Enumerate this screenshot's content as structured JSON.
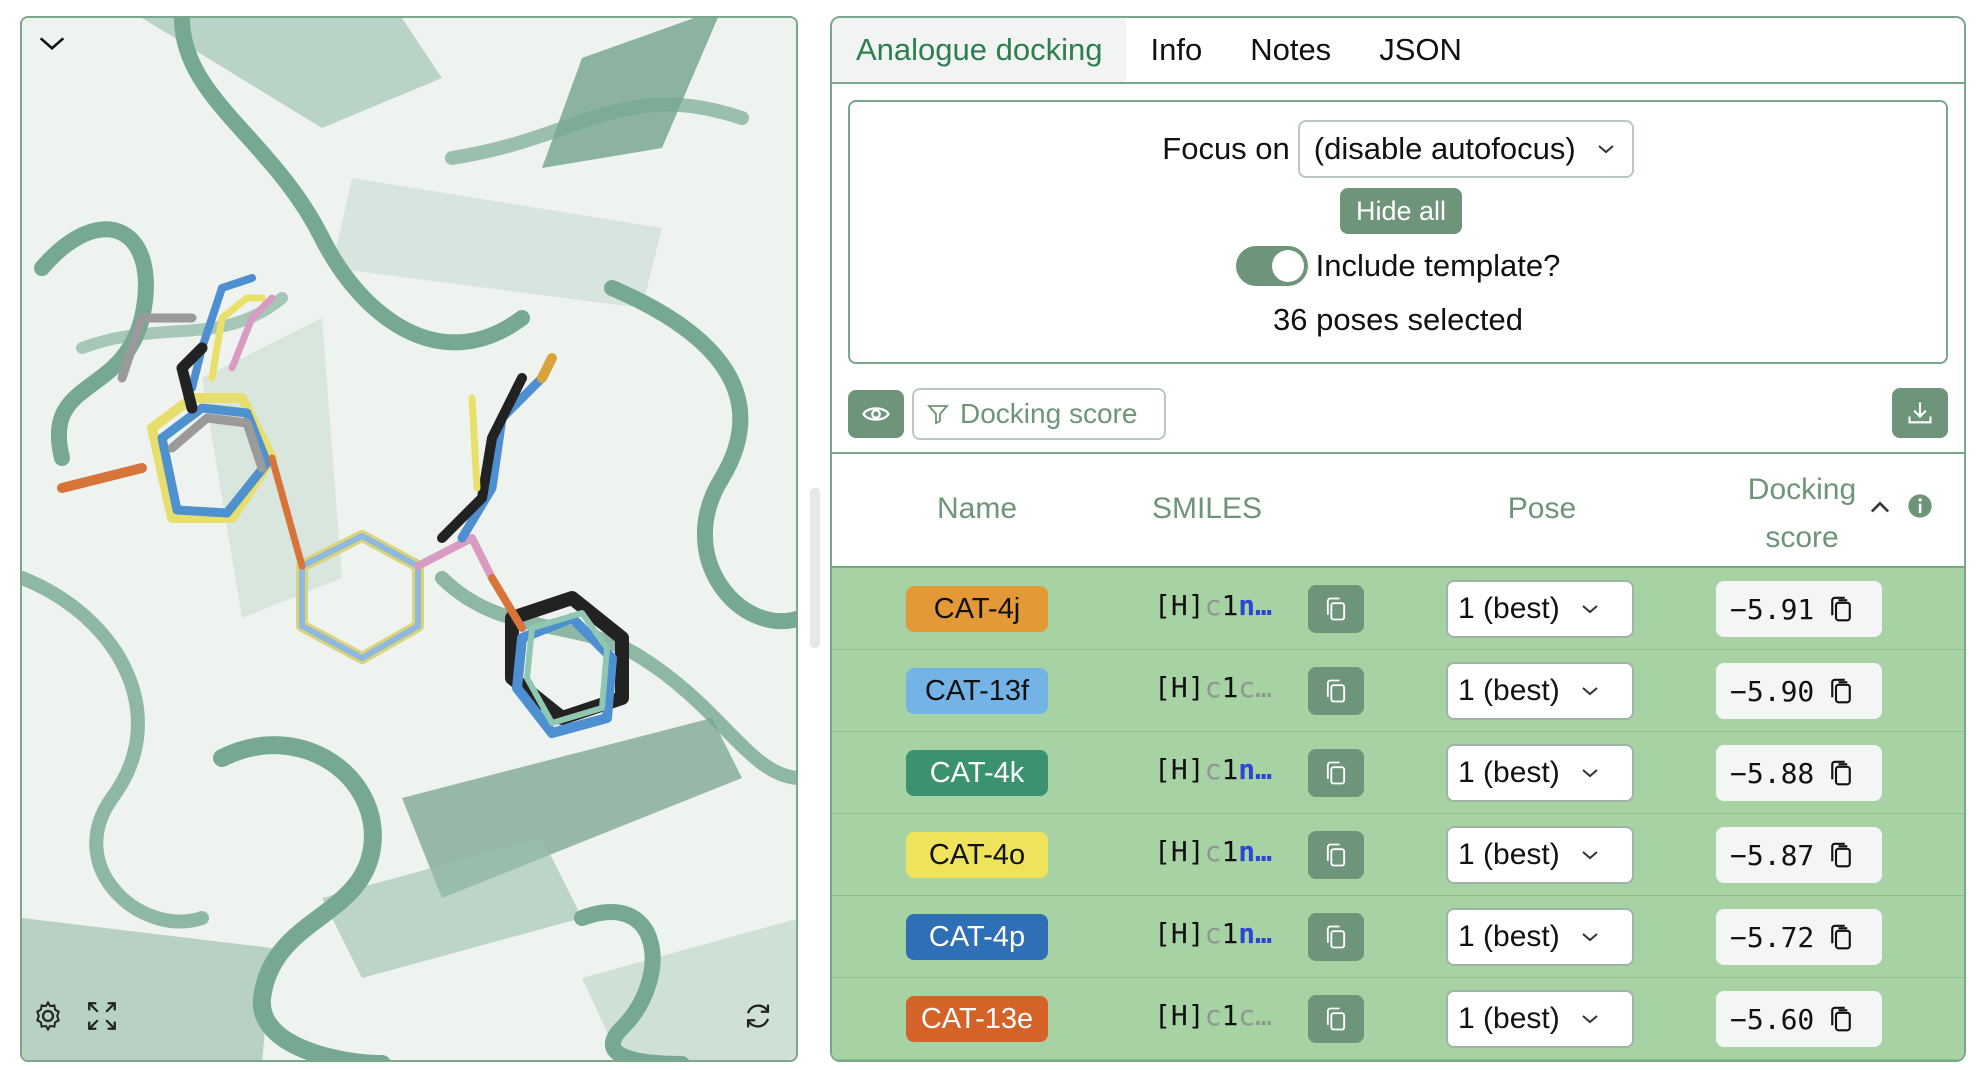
{
  "viewer": {
    "icons": {
      "collapse": "chevron-down-icon",
      "settings": "gear-icon",
      "fullscreen": "expand-icon",
      "reset": "refresh-icon"
    },
    "colors": {
      "ribbon": "#6fa58e",
      "ligand_gray": "#9a9a9a",
      "ligand_black": "#222222",
      "ligand_blue": "#4d8fd1",
      "ligand_yellow": "#e9e06a",
      "ligand_pink": "#d89bc2",
      "ligand_orange": "#d8743a"
    }
  },
  "tabs": [
    {
      "label": "Analogue docking",
      "active": true
    },
    {
      "label": "Info",
      "active": false
    },
    {
      "label": "Notes",
      "active": false
    },
    {
      "label": "JSON",
      "active": false
    }
  ],
  "controls": {
    "focus_label": "Focus on",
    "focus_value": "(disable autofocus)",
    "hide_all_label": "Hide all",
    "include_template_label": "Include template?",
    "include_template_on": true,
    "poses_selected": "36 poses selected"
  },
  "toolbar": {
    "eye_icon": "eye-icon",
    "filter_label": "Docking score",
    "filter_icon": "filter-icon",
    "download_icon": "download-icon"
  },
  "table": {
    "headers": {
      "name": "Name",
      "smiles": "SMILES",
      "pose": "Pose",
      "score_line1": "Docking",
      "score_line2": "score"
    },
    "sort_icon": "chevron-up-icon",
    "info_icon": "info-icon",
    "rows": [
      {
        "name": "CAT-4j",
        "name_bg": "#e39a36",
        "name_fg": "#111111",
        "smiles_prefix": "[H]",
        "smiles_g": "c",
        "smiles_d": "1",
        "smiles_tail": "n…",
        "smiles_tail_style": "n",
        "pose": "1 (best)",
        "score": "−5.91"
      },
      {
        "name": "CAT-13f",
        "name_bg": "#73b3e6",
        "name_fg": "#111111",
        "smiles_prefix": "[H]",
        "smiles_g": "c",
        "smiles_d": "1",
        "smiles_tail": "c…",
        "smiles_tail_style": "g",
        "pose": "1 (best)",
        "score": "−5.90"
      },
      {
        "name": "CAT-4k",
        "name_bg": "#3a9270",
        "name_fg": "#ffffff",
        "smiles_prefix": "[H]",
        "smiles_g": "c",
        "smiles_d": "1",
        "smiles_tail": "n…",
        "smiles_tail_style": "n",
        "pose": "1 (best)",
        "score": "−5.88"
      },
      {
        "name": "CAT-4o",
        "name_bg": "#efe35b",
        "name_fg": "#111111",
        "smiles_prefix": "[H]",
        "smiles_g": "c",
        "smiles_d": "1",
        "smiles_tail": "n…",
        "smiles_tail_style": "n",
        "pose": "1 (best)",
        "score": "−5.87"
      },
      {
        "name": "CAT-4p",
        "name_bg": "#2f6fb5",
        "name_fg": "#ffffff",
        "smiles_prefix": "[H]",
        "smiles_g": "c",
        "smiles_d": "1",
        "smiles_tail": "n…",
        "smiles_tail_style": "n",
        "pose": "1 (best)",
        "score": "−5.72"
      },
      {
        "name": "CAT-13e",
        "name_bg": "#d4632a",
        "name_fg": "#ffffff",
        "smiles_prefix": "[H]",
        "smiles_g": "c",
        "smiles_d": "1",
        "smiles_tail": "c…",
        "smiles_tail_style": "g",
        "pose": "1 (best)",
        "score": "−5.60"
      }
    ],
    "copy_icon": "copy-icon",
    "dropdown_icon": "chevron-down-icon"
  }
}
